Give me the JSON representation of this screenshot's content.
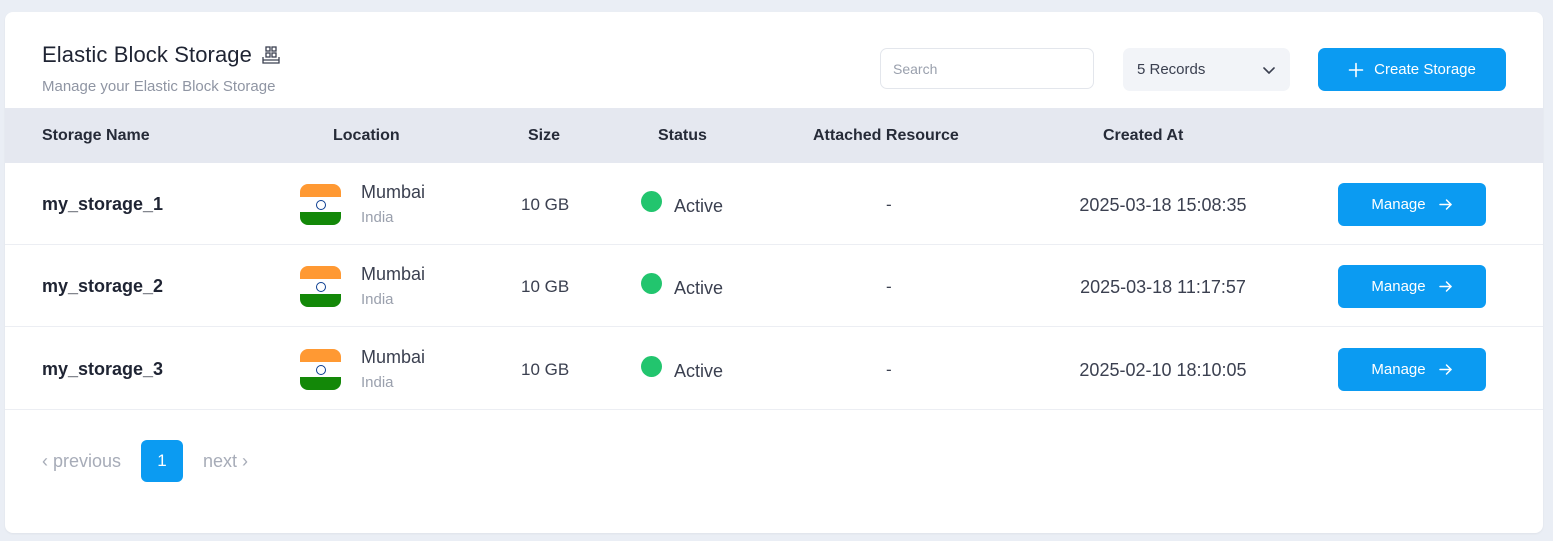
{
  "header": {
    "title": "Elastic Block Storage",
    "subtitle": "Manage your Elastic Block Storage",
    "title_icon": "storage-grid-icon"
  },
  "toolbar": {
    "search_placeholder": "Search",
    "records_label": "5 Records",
    "create_label": "Create Storage"
  },
  "table": {
    "columns": [
      "Storage Name",
      "Location",
      "Size",
      "Status",
      "Attached Resource",
      "Created At"
    ],
    "rows": [
      {
        "name": "my_storage_1",
        "city": "Mumbai",
        "country": "India",
        "size": "10 GB",
        "status": "Active",
        "attached": "-",
        "created": "2025-03-18 15:08:35",
        "action": "Manage"
      },
      {
        "name": "my_storage_2",
        "city": "Mumbai",
        "country": "India",
        "size": "10 GB",
        "status": "Active",
        "attached": "-",
        "created": "2025-03-18 11:17:57",
        "action": "Manage"
      },
      {
        "name": "my_storage_3",
        "city": "Mumbai",
        "country": "India",
        "size": "10 GB",
        "status": "Active",
        "attached": "-",
        "created": "2025-02-10 18:10:05",
        "action": "Manage"
      }
    ]
  },
  "pagination": {
    "previous": "‹ previous",
    "current": "1",
    "next": "next ›"
  },
  "colors": {
    "accent": "#0b9bf2",
    "status_active": "#22c56e",
    "table_header_bg": "#e5e8f0"
  }
}
